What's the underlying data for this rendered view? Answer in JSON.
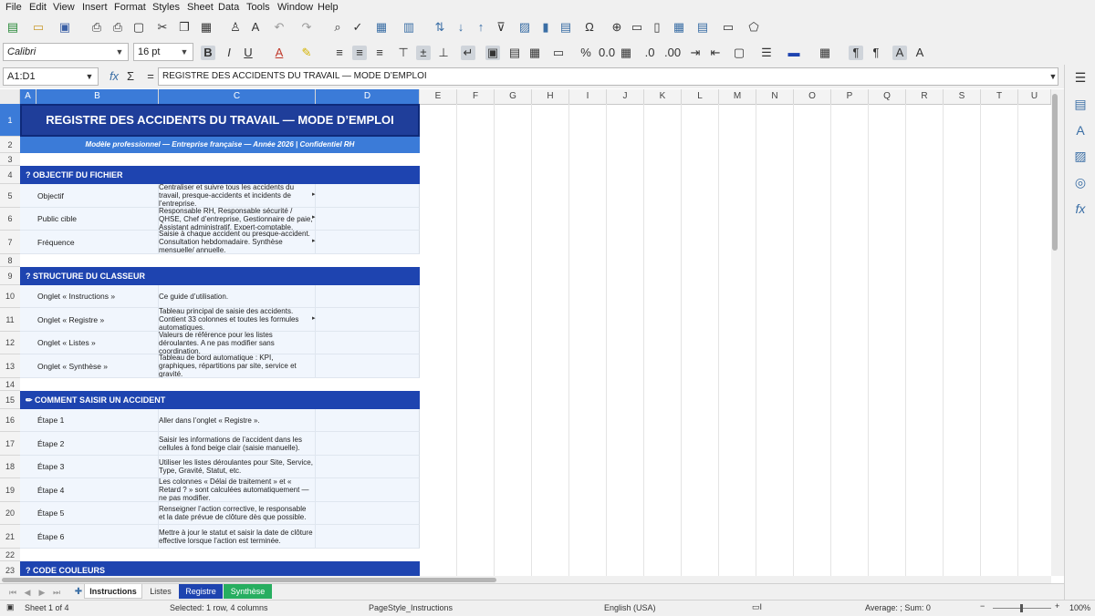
{
  "menu": [
    "File",
    "Edit",
    "View",
    "Insert",
    "Format",
    "Styles",
    "Sheet",
    "Data",
    "Tools",
    "Window",
    "Help"
  ],
  "toolbar": {
    "font_name": "Calibri",
    "font_size": "16 pt"
  },
  "formula_bar": {
    "name_box": "A1:D1",
    "content": "REGISTRE DES ACCIDENTS DU TRAVAIL — MODE D’EMPLOI"
  },
  "columns": [
    "A",
    "B",
    "C",
    "D",
    "E",
    "F",
    "G",
    "H",
    "I",
    "J",
    "K",
    "L",
    "M",
    "N",
    "O",
    "P",
    "Q",
    "R",
    "S",
    "T",
    "U"
  ],
  "rows": [
    "1",
    "2",
    "3",
    "4",
    "5",
    "6",
    "7",
    "8",
    "9",
    "10",
    "11",
    "12",
    "13",
    "14",
    "15",
    "16",
    "17",
    "18",
    "19",
    "20",
    "21",
    "22",
    "23"
  ],
  "sheet": {
    "title": "REGISTRE DES ACCIDENTS DU TRAVAIL — MODE D’EMPLOI",
    "subtitle": "Modèle professionnel — Entreprise française — Année 2026   |   Confidentiel RH",
    "sections": [
      {
        "header": "? OBJECTIF DU FICHIER",
        "items": [
          {
            "label": "Objectif",
            "text": "Centraliser et suivre tous les accidents du travail, presque-accidents et incidents de l’entreprise."
          },
          {
            "label": "Public cible",
            "text": "Responsable RH, Responsable sécurité / QHSE, Chef d’entreprise, Gestionnaire de paie, Assistant administratif, Expert-comptable."
          },
          {
            "label": "Fréquence",
            "text": "Saisie à chaque accident ou presque-accident. Consultation hebdomadaire. Synthèse mensuelle/ annuelle."
          }
        ]
      },
      {
        "header": "? STRUCTURE DU CLASSEUR",
        "items": [
          {
            "label": "Onglet « Instructions »",
            "text": "Ce guide d’utilisation."
          },
          {
            "label": "Onglet « Registre »",
            "text": "Tableau principal de saisie des accidents. Contient 33 colonnes et toutes les formules automatiques."
          },
          {
            "label": "Onglet « Listes »",
            "text": "Valeurs de référence pour les listes déroulantes. A ne pas modifier sans coordination."
          },
          {
            "label": "Onglet « Synthèse »",
            "text": "Tableau de bord automatique : KPI, graphiques, répartitions par site, service et gravité."
          }
        ]
      },
      {
        "header": "✏ COMMENT SAISIR UN ACCIDENT",
        "items": [
          {
            "label": "Étape 1",
            "text": "Aller dans l’onglet « Registre »."
          },
          {
            "label": "Étape 2",
            "text": "Saisir les informations de l’accident dans les cellules à fond beige clair (saisie manuelle)."
          },
          {
            "label": "Étape 3",
            "text": "Utiliser les listes déroulantes pour Site, Service, Type, Gravité, Statut, etc."
          },
          {
            "label": "Étape 4",
            "text": "Les colonnes « Délai de traitement » et « Retard ? » sont calculées automatiquement — ne pas modifier."
          },
          {
            "label": "Étape 5",
            "text": "Renseigner l’action corrective, le responsable et la date prévue de clôture dès que possible."
          },
          {
            "label": "Étape 6",
            "text": "Mettre à jour le statut et saisir la date de clôture effective lorsque l’action est terminée."
          }
        ]
      },
      {
        "header": "? CODE COULEURS",
        "items": []
      }
    ]
  },
  "tabs": [
    "Instructions",
    "Listes",
    "Registre",
    "Synthèse"
  ],
  "status": {
    "sheet": "Sheet 1 of 4",
    "selection": "Selected: 1 row, 4 columns",
    "page_style": "PageStyle_Instructions",
    "language": "English (USA)",
    "summary": "Average: ; Sum: 0",
    "zoom": "100%"
  },
  "colors": {
    "header_blue": "#1e44b0",
    "title_blue": "#1f3e9a",
    "subtitle_blue": "#3b7bd8",
    "cell_bg": "#f1f6fd",
    "tab_registre": "#1e44b0",
    "tab_synthese": "#27ae60"
  }
}
